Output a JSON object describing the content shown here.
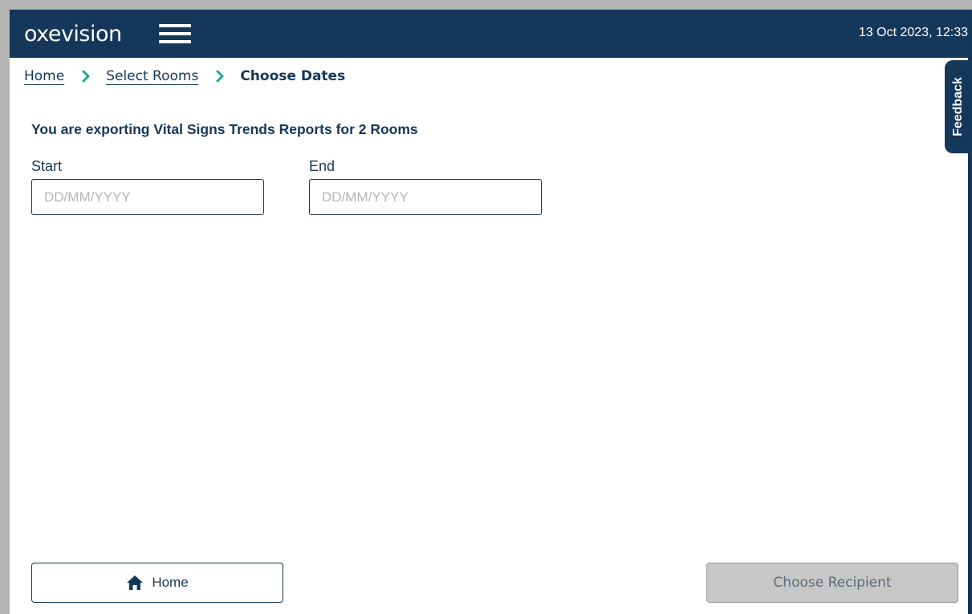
{
  "header": {
    "logo_text": "oxevision",
    "datetime": "13 Oct 2023, 12:33"
  },
  "breadcrumb": {
    "items": [
      {
        "label": "Home"
      },
      {
        "label": "Select Rooms"
      },
      {
        "label": "Choose Dates"
      }
    ]
  },
  "feedback": {
    "label": "Feedback"
  },
  "main": {
    "title": "You are exporting Vital Signs Trends Reports for 2 Rooms",
    "start": {
      "label": "Start",
      "placeholder": "DD/MM/YYYY",
      "value": ""
    },
    "end": {
      "label": "End",
      "placeholder": "DD/MM/YYYY",
      "value": ""
    }
  },
  "footer": {
    "home_label": "Home",
    "choose_recipient_label": "Choose Recipient"
  },
  "colors": {
    "brand_navy": "#15375a",
    "accent_green": "#1aab8f",
    "disabled_gray": "#c7c7c7"
  },
  "icons": {
    "menu": "hamburger-menu-icon",
    "breadcrumb_separator": "chevron-right-icon",
    "home": "home-icon"
  }
}
